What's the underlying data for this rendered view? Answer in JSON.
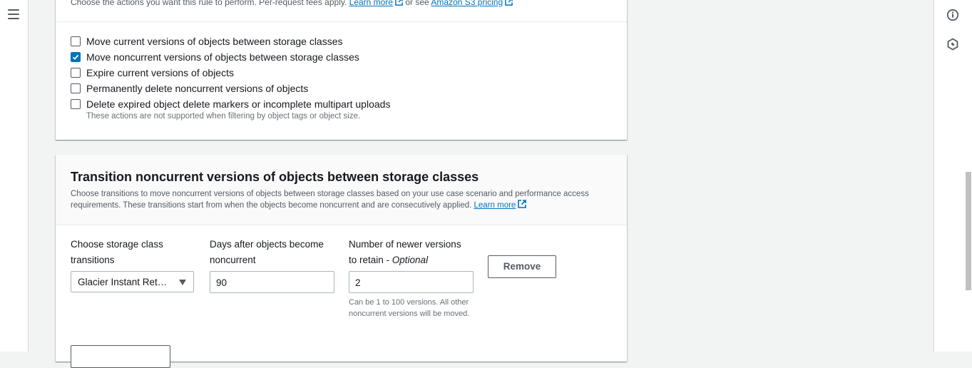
{
  "nav": {
    "menu_icon": "hamburger-icon"
  },
  "rightbar": {
    "icons": [
      "info-icon",
      "hexagon-icon"
    ]
  },
  "actions_panel": {
    "intro_text": "Choose the actions you want this rule to perform. Per-request fees apply.",
    "learn_more": "Learn more",
    "or_see": "or see",
    "pricing_link": "Amazon S3 pricing",
    "checkboxes": [
      {
        "label": "Move current versions of objects between storage classes",
        "checked": false
      },
      {
        "label": "Move noncurrent versions of objects between storage classes",
        "checked": true
      },
      {
        "label": "Expire current versions of objects",
        "checked": false
      },
      {
        "label": "Permanently delete noncurrent versions of objects",
        "checked": false
      },
      {
        "label": "Delete expired object delete markers or incomplete multipart uploads",
        "checked": false
      }
    ],
    "note": "These actions are not supported when filtering by object tags or object size."
  },
  "transition_panel": {
    "title": "Transition noncurrent versions of objects between storage classes",
    "description": "Choose transitions to move noncurrent versions of objects between storage classes based on your use case scenario and performance access requirements. These transitions start from when the objects become noncurrent and are consecutively applied.",
    "learn_more": "Learn more",
    "storage_class_label_1": "Choose storage class",
    "storage_class_label_2": "transitions",
    "storage_class_value": "Glacier Instant Ret…",
    "days_label_1": "Days after objects become",
    "days_label_2": "noncurrent",
    "days_value": "90",
    "versions_label_1": "Number of newer versions",
    "versions_label_2": "to retain - ",
    "versions_optional": "Optional",
    "versions_value": "2",
    "versions_hint": "Can be 1 to 100 versions. All other noncurrent versions will be moved.",
    "remove_button": "Remove"
  },
  "colors": {
    "accent": "#0073bb",
    "border": "#aab7b8",
    "text_secondary": "#545b64"
  }
}
